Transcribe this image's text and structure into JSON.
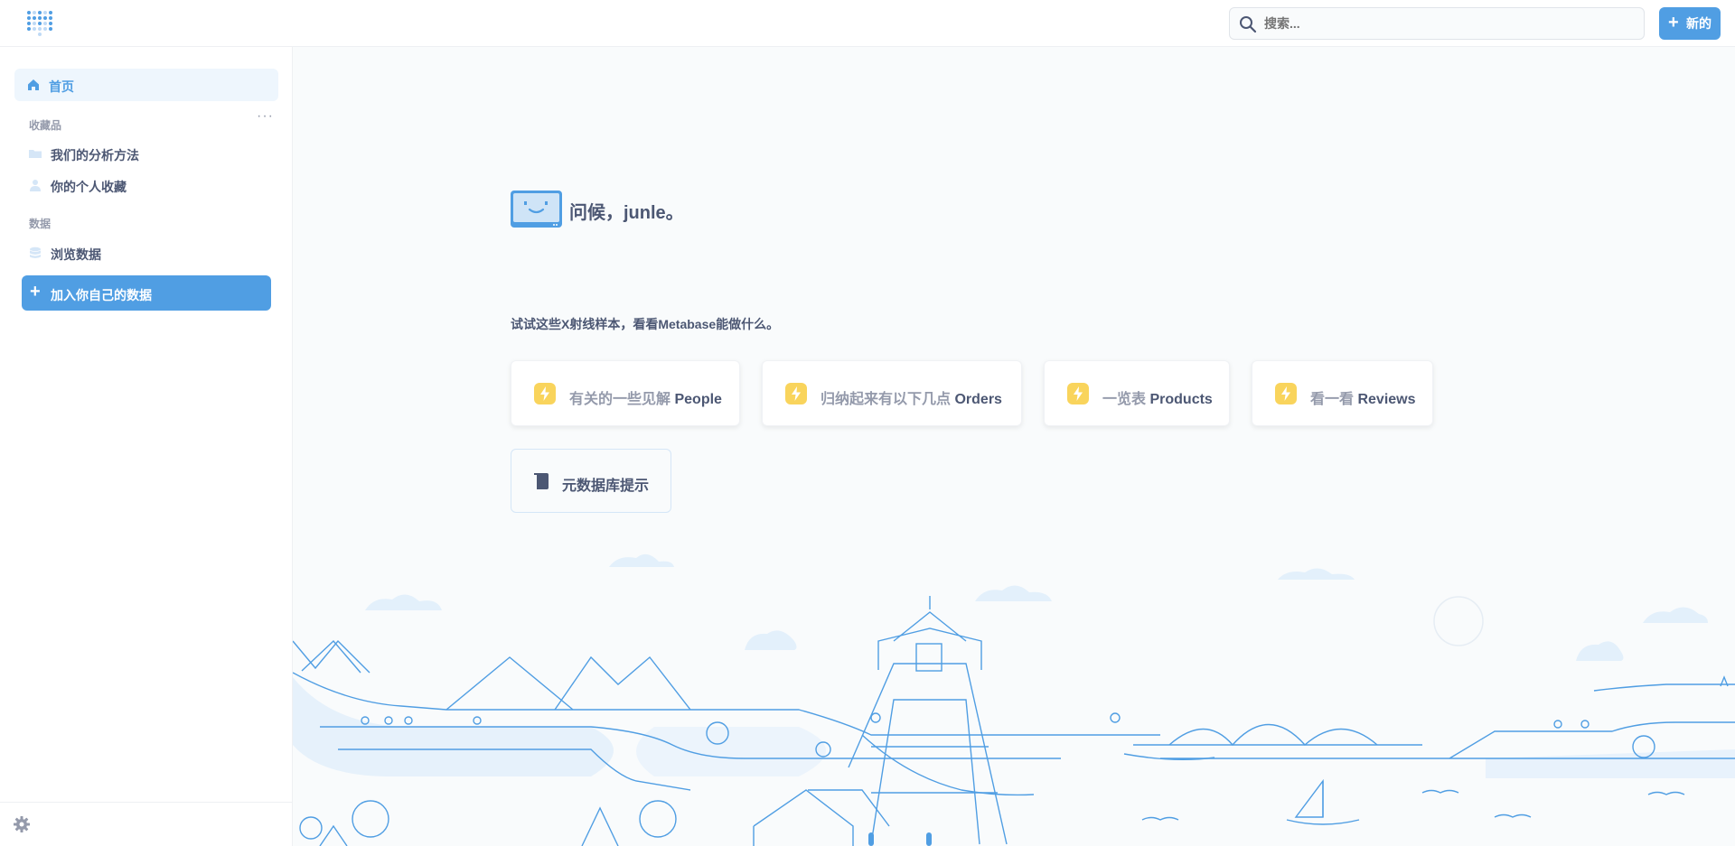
{
  "header": {
    "search_placeholder": "搜索...",
    "new_label": "新的"
  },
  "sidebar": {
    "home_label": "首页",
    "collections_title": "收藏品",
    "collections_more": "···",
    "collections": [
      {
        "label": "我们的分析方法",
        "icon": "folder-icon"
      },
      {
        "label": "你的个人收藏",
        "icon": "person-icon"
      }
    ],
    "data_title": "数据",
    "browse_label": "浏览数据",
    "add_data_label": "加入你自己的数据"
  },
  "main": {
    "greeting": "问候，junle。",
    "xray_title": "试试这些X射线样本，看看Metabase能做什么。",
    "xray_cards": [
      {
        "prefix": "有关的一些见解",
        "table": "People"
      },
      {
        "prefix": "归纳起来有以下几点",
        "table": "Orders"
      },
      {
        "prefix": "一览表",
        "table": "Products"
      },
      {
        "prefix": "看一看",
        "table": "Reviews"
      }
    ],
    "metabot_label": "元数据库提示"
  },
  "colors": {
    "brand": "#509ee3",
    "text": "#4c5773",
    "muted": "#949aab",
    "bolt": "#f9d45c"
  }
}
